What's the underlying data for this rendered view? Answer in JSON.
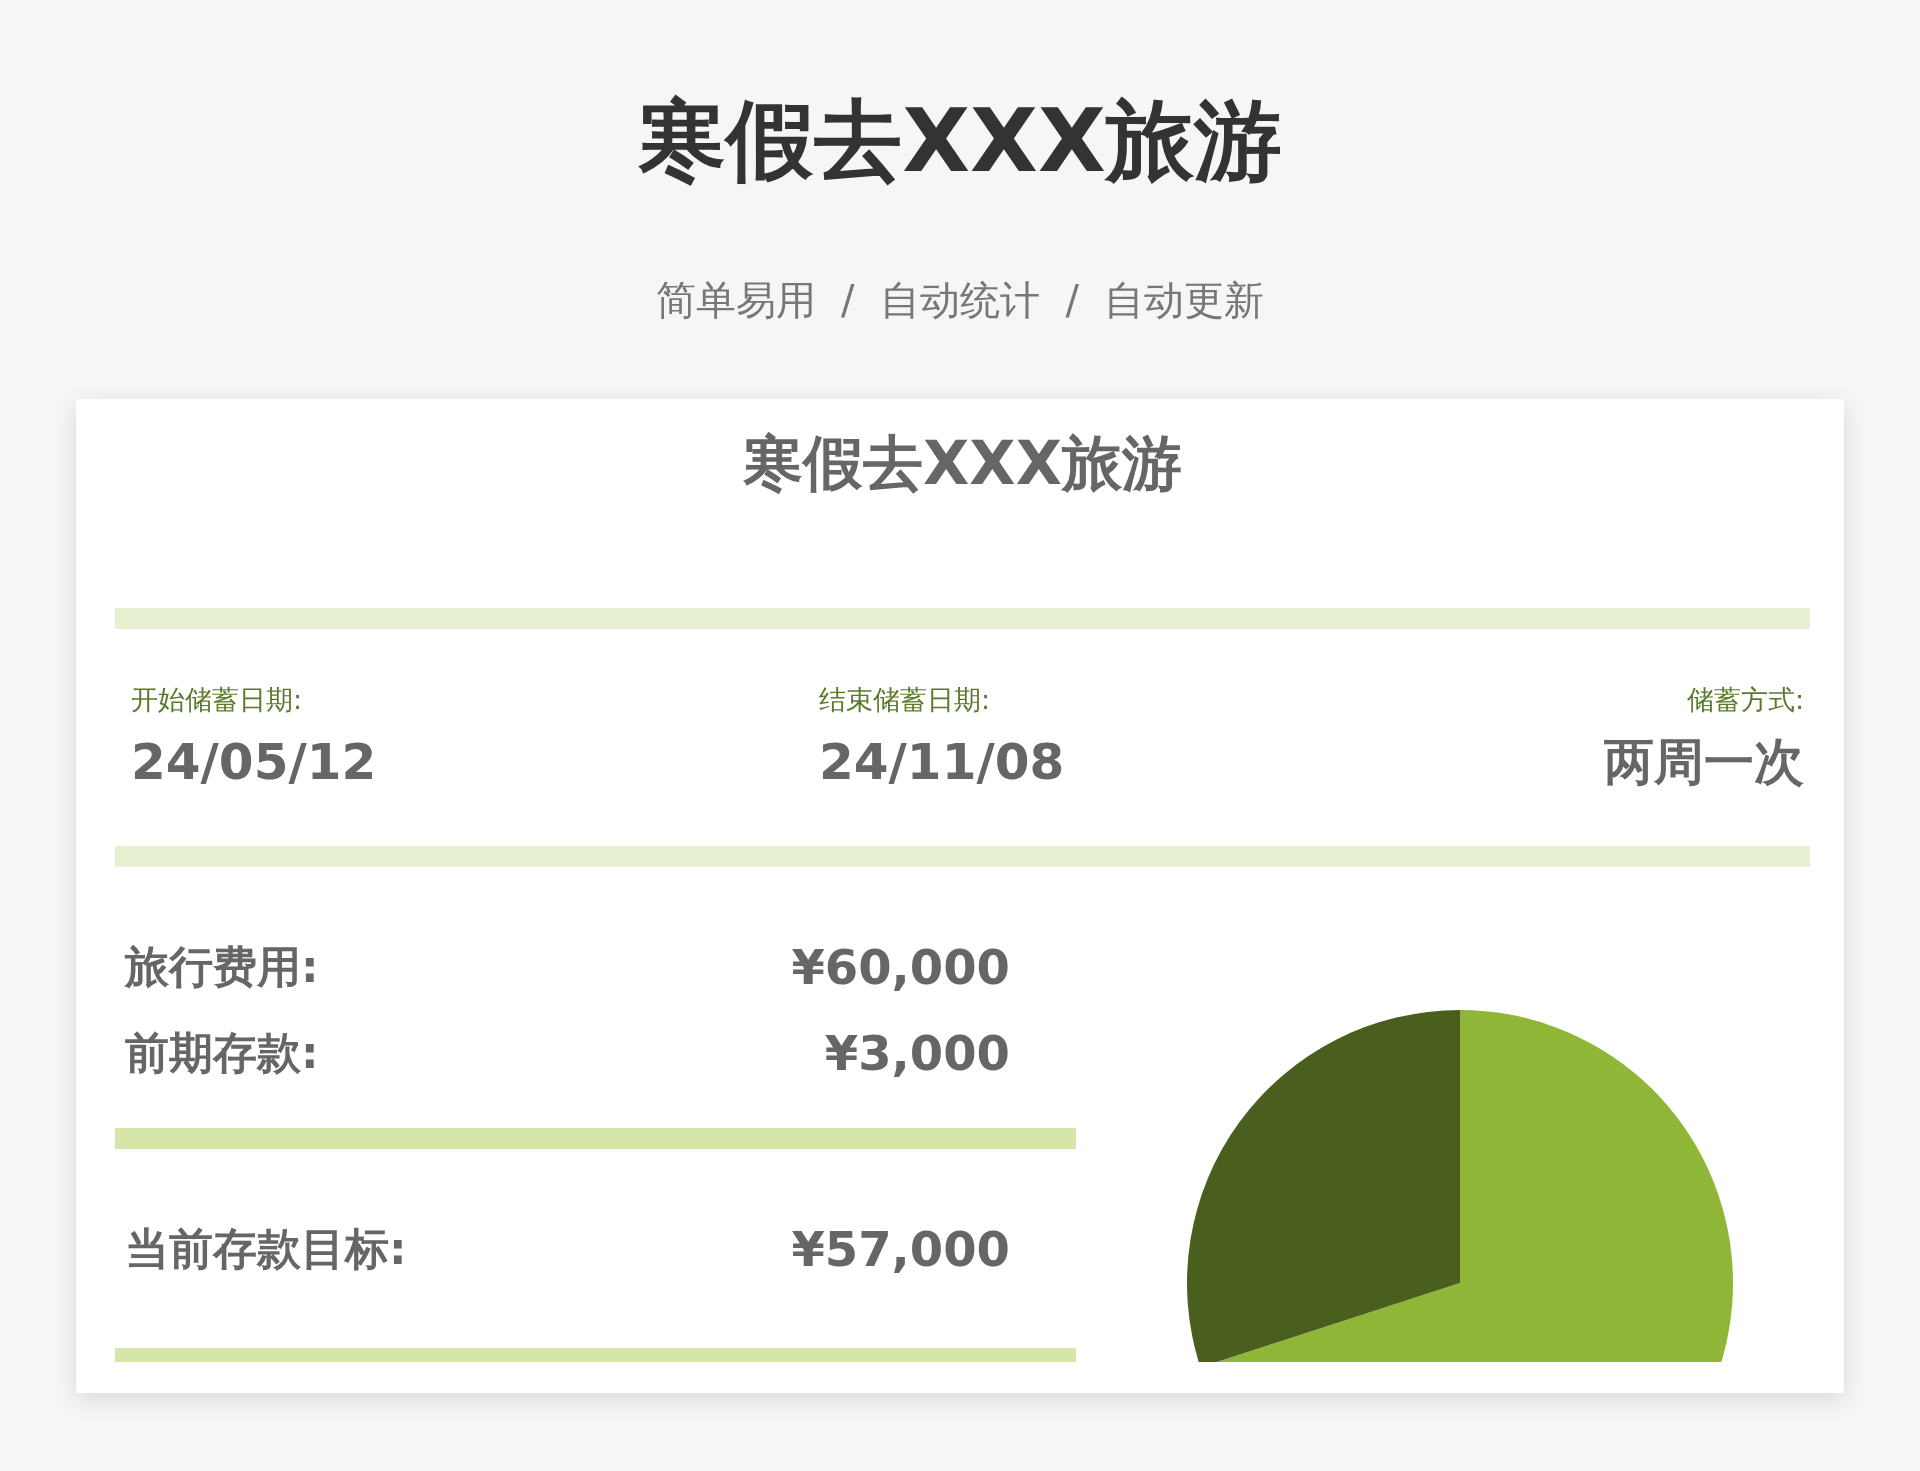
{
  "page": {
    "title": "寒假去XXX旅游",
    "subtitle": "简单易用  /  自动统计  /  自动更新"
  },
  "card": {
    "title": "寒假去XXX旅游",
    "info": [
      {
        "label": "开始储蓄日期:",
        "value": "24/05/12"
      },
      {
        "label": "结束储蓄日期:",
        "value": "24/11/08"
      },
      {
        "label": "储蓄方式:",
        "value": "两周一次"
      }
    ],
    "amounts": [
      {
        "label": "旅行费用:",
        "value": "¥60,000"
      },
      {
        "label": "前期存款:",
        "value": "¥3,000"
      }
    ],
    "target": {
      "label": "当前存款目标:",
      "value": "¥57,000"
    }
  }
}
